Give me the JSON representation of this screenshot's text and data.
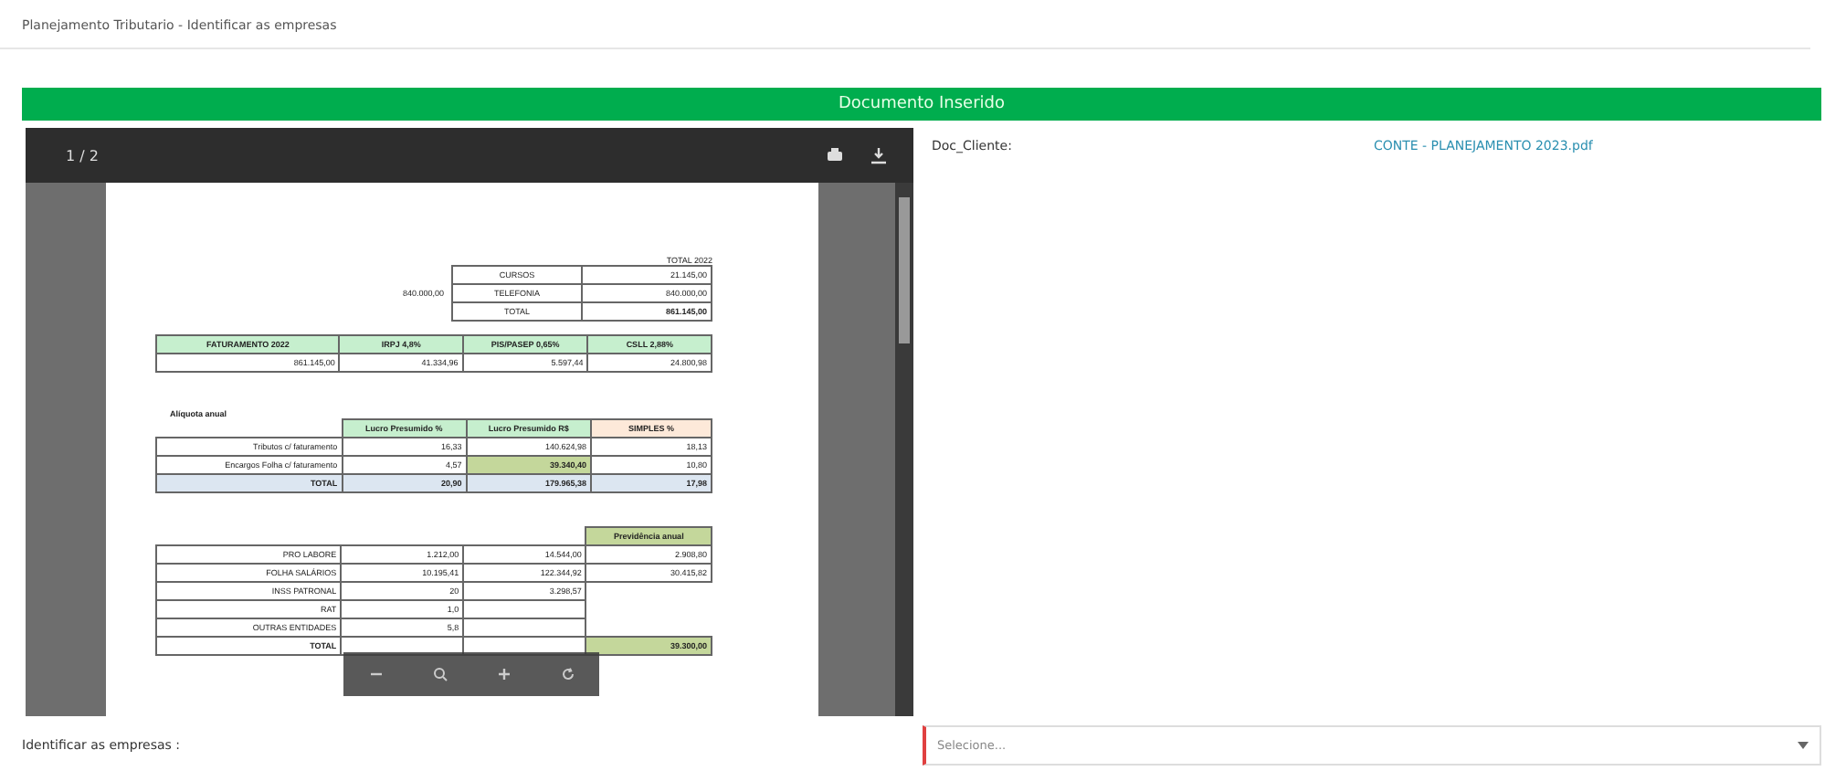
{
  "breadcrumb": "Planejamento Tributario - Identificar as empresas",
  "banner": "Documento Inserido",
  "viewer": {
    "page_indicator": "1 / 2",
    "summary": {
      "header": "TOTAL 2022",
      "side_value": "840.000,00",
      "rows": [
        {
          "label": "CURSOS",
          "value": "21.145,00",
          "kind": "normal"
        },
        {
          "label": "TELEFONIA",
          "value": "840.000,00",
          "kind": "normal"
        },
        {
          "label": "TOTAL",
          "value": "861.145,00",
          "kind": "total"
        }
      ]
    },
    "taxes": {
      "columns": [
        "FATURAMENTO 2022",
        "IRPJ 4,8%",
        "PIS/PASEP 0,65%",
        "CSLL 2,88%"
      ],
      "values": [
        "861.145,00",
        "41.334,96",
        "5.597,44",
        "24.800,98"
      ]
    },
    "rates": {
      "title": "Alíquota anual",
      "columns": [
        "Lucro Presumido %",
        "Lucro Presumido R$",
        "SIMPLES %"
      ],
      "rows": [
        {
          "label": "Tributos c/ faturamento",
          "percent": "16,33",
          "amount": "140.624,98",
          "simples": "18,13",
          "kind": "normal"
        },
        {
          "label": "Encargos Folha c/ faturamento",
          "percent": "4,57",
          "amount": "39.340,40",
          "simples": "10,80",
          "kind": "highlight"
        },
        {
          "label": "TOTAL",
          "percent": "20,90",
          "amount": "179.965,38",
          "simples": "17,98",
          "kind": "total"
        }
      ]
    },
    "payroll": {
      "header": "Previdência anual",
      "rows": [
        {
          "label": "PRO LABORE",
          "cells": [
            "1.212,00",
            "14.544,00"
          ],
          "annual": "2.908,80",
          "kind": "normal"
        },
        {
          "label": "FOLHA SALÁRIOS",
          "cells": [
            "10.195,41",
            "122.344,92"
          ],
          "annual": "30.415,82",
          "kind": "normal"
        },
        {
          "label": "INSS PATRONAL",
          "cells": [
            "20",
            "3.298,57"
          ],
          "kind": "normal"
        },
        {
          "label": "RAT",
          "cells": [
            "1,0"
          ],
          "kind": "normal"
        },
        {
          "label": "OUTRAS ENTIDADES",
          "cells": [
            "5,8"
          ],
          "kind": "normal"
        },
        {
          "label": "TOTAL",
          "cells": [],
          "annual": "39.300,00",
          "kind": "total"
        }
      ]
    }
  },
  "doc_field": {
    "label": "Doc_Cliente:",
    "file": "CONTE - PLANEJAMENTO 2023.pdf"
  },
  "company_field": {
    "label": "Identificar as empresas :",
    "placeholder": "Selecione..."
  }
}
